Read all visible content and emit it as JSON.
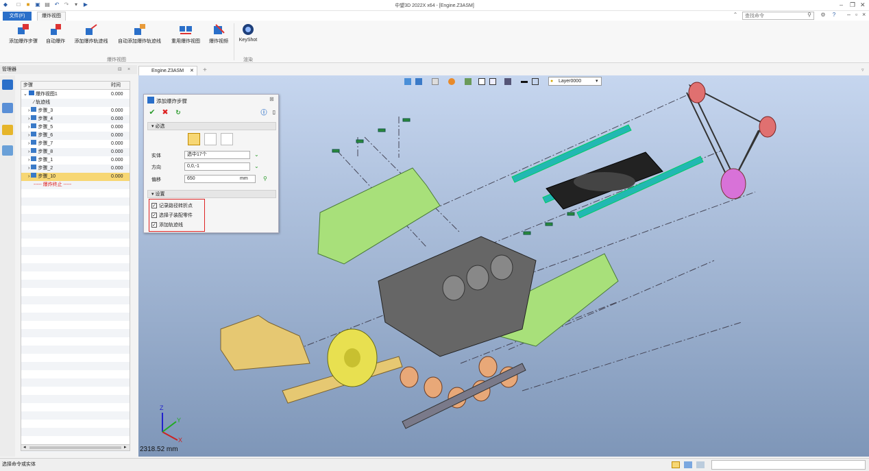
{
  "title": "中望3D 2022X x64 - [Engine.Z3ASM]",
  "tabs": {
    "file": "文件(F)",
    "explode": "爆炸视图"
  },
  "search": {
    "placeholder": "查找命令"
  },
  "ribbon": {
    "buttons": [
      "添加爆炸步骤",
      "自动爆炸",
      "添加爆炸轨迹线",
      "自动添加爆炸轨迹线",
      "重用爆炸视图",
      "爆炸视频",
      "KeyShot"
    ],
    "group1": "爆炸视图",
    "group2": "渲染"
  },
  "manager": {
    "title": "管理器",
    "col_step": "步骤",
    "col_time": "时间",
    "rows": [
      {
        "label": "爆炸视图1",
        "time": "0.000"
      },
      {
        "label": "轨迹线",
        "time": ""
      },
      {
        "label": "步骤_3",
        "time": "0.000"
      },
      {
        "label": "步骤_4",
        "time": "0.000"
      },
      {
        "label": "步骤_5",
        "time": "0.000"
      },
      {
        "label": "步骤_6",
        "time": "0.000"
      },
      {
        "label": "步骤_7",
        "time": "0.000"
      },
      {
        "label": "步骤_8",
        "time": "0.000"
      },
      {
        "label": "步骤_1",
        "time": "0.000"
      },
      {
        "label": "步骤_2",
        "time": "0.000"
      },
      {
        "label": "步骤_10",
        "time": "0.000"
      },
      {
        "label": "----- 爆炸终止 -----",
        "time": ""
      }
    ]
  },
  "doc_tab": "Engine.Z3ASM",
  "viewport": {
    "layer": "Layer0000",
    "scale": "2318.52 mm"
  },
  "dialog": {
    "title": "添加爆炸步骤",
    "required": "必选",
    "settings": "设置",
    "entity_label": "实体",
    "entity_value": "选中17个",
    "direction_label": "方向",
    "direction_value": "0,0,-1",
    "offset_label": "偏移",
    "offset_value": "650",
    "offset_unit": "mm",
    "checks": [
      "记录路径转折点",
      "选择子装配零件",
      "添加轨迹线"
    ]
  },
  "status": "选择命令或实体",
  "colors": {
    "accent": "#2a6fc9",
    "highlight": "#f7d774",
    "green_part": "#a8e07a",
    "teal_part": "#1fb5b0",
    "gold_part": "#e6c872",
    "red_frame": "#d22222"
  }
}
